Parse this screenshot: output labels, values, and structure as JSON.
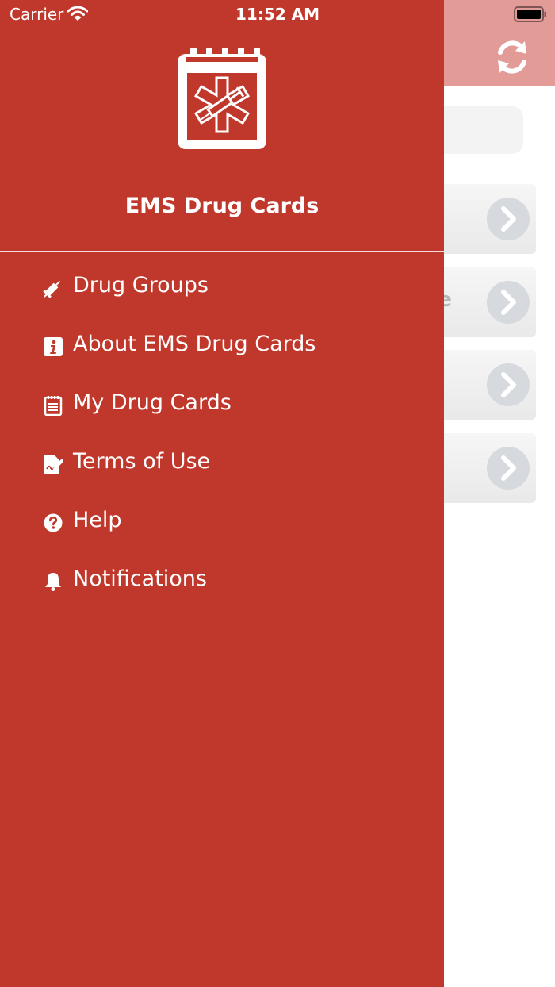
{
  "status_bar": {
    "carrier": "Carrier",
    "time": "11:52 AM"
  },
  "drawer": {
    "app_title": "EMS Drug Cards",
    "menu_items": [
      {
        "label": "Drug Groups",
        "icon": "syringe-icon"
      },
      {
        "label": "About EMS Drug Cards",
        "icon": "info-icon"
      },
      {
        "label": "My Drug Cards",
        "icon": "notepad-icon"
      },
      {
        "label": "Terms of Use",
        "icon": "signature-icon"
      },
      {
        "label": "Help",
        "icon": "question-icon"
      },
      {
        "label": "Notifications",
        "icon": "bell-icon"
      }
    ]
  },
  "background": {
    "row_partial_text": "te"
  },
  "colors": {
    "drawer_bg": "#c0372b",
    "nav_bg_dimmed": "#e29b97",
    "text": "#ffffff"
  }
}
